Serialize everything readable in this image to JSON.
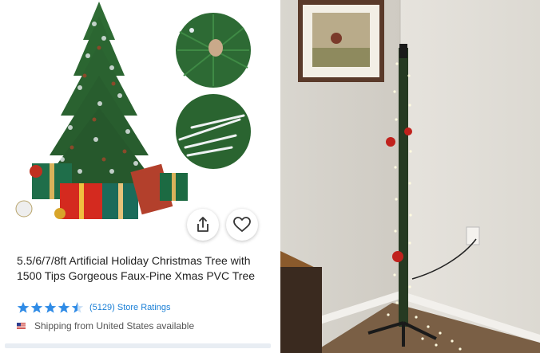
{
  "product": {
    "title": "5.5/6/7/8ft Artificial Holiday Christmas Tree with 1500 Tips Gorgeous Faux-Pine Xmas PVC Tree",
    "rating": 4.5,
    "rating_text": "(5129) Store Ratings",
    "shipping_text": "Shipping from United States available"
  },
  "icons": {
    "share": "share-icon",
    "favorite": "heart-icon",
    "star": "star-icon",
    "flag": "us-flag-icon"
  },
  "colors": {
    "star": "#2f8be6",
    "link": "#1a7fd6",
    "title": "#222222"
  }
}
